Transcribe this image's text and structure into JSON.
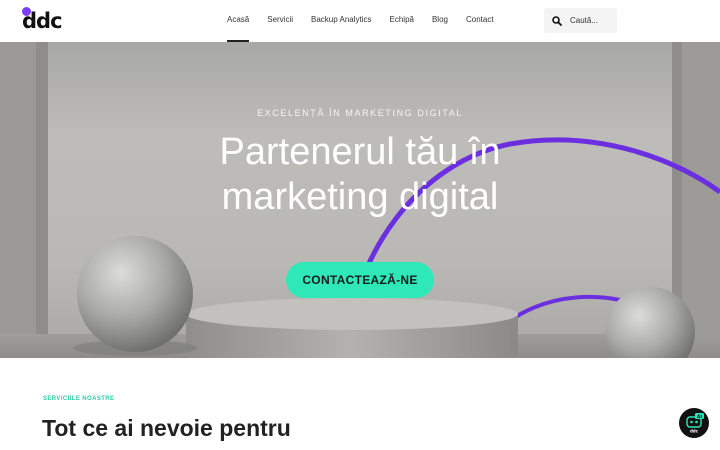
{
  "brand": {
    "logo_text": "ddc",
    "accent_color": "#7a3cff"
  },
  "nav": {
    "items": [
      {
        "label": "Acasă",
        "active": true
      },
      {
        "label": "Servicii",
        "active": false
      },
      {
        "label": "Backup Analytics",
        "active": false
      },
      {
        "label": "Echipă",
        "active": false
      },
      {
        "label": "Blog",
        "active": false
      },
      {
        "label": "Contact",
        "active": false
      }
    ]
  },
  "search": {
    "placeholder": "Caută...",
    "icon": "search-icon"
  },
  "hero": {
    "eyebrow": "EXCELENȚĂ ÎN MARKETING DIGITAL",
    "title_line1": "Partenerul tău în",
    "title_line2": "marketing digital",
    "cta_label": "CONTACTEAZĂ-NE",
    "cta_color": "#2ee8b7",
    "arc_color": "#6b2fe0"
  },
  "services": {
    "label": "SERVICIILE NOASTRE",
    "label_color": "#2ec9a7",
    "title": "Tot ce ai nevoie pentru"
  },
  "chat_widget": {
    "icon": "ai-chat-icon",
    "badge_text": "AI",
    "caption": "ddc"
  }
}
